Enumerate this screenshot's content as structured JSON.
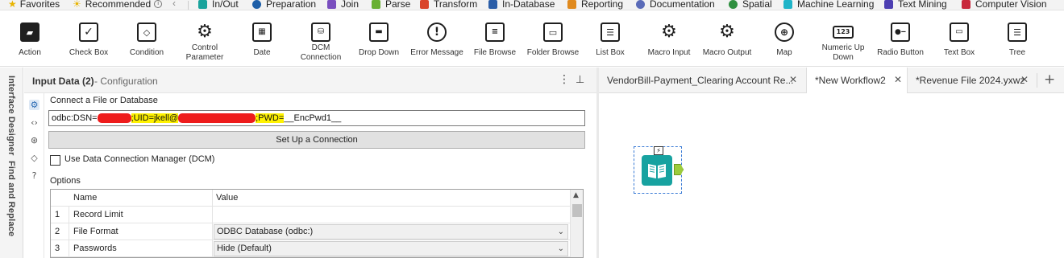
{
  "categories": [
    {
      "label": "Favorites",
      "color": "#e8b400",
      "icon": "star-icon"
    },
    {
      "label": "Recommended",
      "color": "#e8b400",
      "icon": "sun-icon"
    },
    {
      "label": "In/Out",
      "color": "#1aa39c",
      "icon": "in-out-icon"
    },
    {
      "label": "Preparation",
      "color": "#1e5fa8",
      "icon": "preparation-icon"
    },
    {
      "label": "Join",
      "color": "#7a4fbf",
      "icon": "join-icon"
    },
    {
      "label": "Parse",
      "color": "#69b032",
      "icon": "parse-icon"
    },
    {
      "label": "Transform",
      "color": "#d9452b",
      "icon": "transform-icon"
    },
    {
      "label": "In-Database",
      "color": "#2b5ea8",
      "icon": "in-database-icon"
    },
    {
      "label": "Reporting",
      "color": "#e08a1e",
      "icon": "reporting-icon"
    },
    {
      "label": "Documentation",
      "color": "#5a6bb8",
      "icon": "documentation-icon"
    },
    {
      "label": "Spatial",
      "color": "#2f8f3f",
      "icon": "spatial-icon"
    },
    {
      "label": "Machine Learning",
      "color": "#1fb4c8",
      "icon": "machine-learning-icon"
    },
    {
      "label": "Text Mining",
      "color": "#4d3fb2",
      "icon": "text-mining-icon"
    },
    {
      "label": "Computer Vision",
      "color": "#c8283c",
      "icon": "computer-vision-icon"
    }
  ],
  "tools": [
    {
      "label": "Action",
      "icon": "clapperboard-icon"
    },
    {
      "label": "Check Box",
      "icon": "checkbox-icon"
    },
    {
      "label": "Condition",
      "icon": "condition-icon"
    },
    {
      "label": "Control Parameter",
      "icon": "gear-icon"
    },
    {
      "label": "Date",
      "icon": "calendar-icon"
    },
    {
      "label": "DCM Connection",
      "icon": "dcm-icon"
    },
    {
      "label": "Drop Down",
      "icon": "dropdown-icon"
    },
    {
      "label": "Error Message",
      "icon": "error-icon"
    },
    {
      "label": "File Browse",
      "icon": "file-browse-icon"
    },
    {
      "label": "Folder Browse",
      "icon": "folder-icon"
    },
    {
      "label": "List Box",
      "icon": "listbox-icon"
    },
    {
      "label": "Macro Input",
      "icon": "macro-input-icon"
    },
    {
      "label": "Macro Output",
      "icon": "macro-output-icon"
    },
    {
      "label": "Map",
      "icon": "globe-icon"
    },
    {
      "label": "Numeric Up Down",
      "icon": "numeric-icon"
    },
    {
      "label": "Radio Button",
      "icon": "radio-icon"
    },
    {
      "label": "Text Box",
      "icon": "textbox-icon"
    },
    {
      "label": "Tree",
      "icon": "tree-icon"
    }
  ],
  "side": {
    "interface_designer": "Interface Designer",
    "find_replace": "Find and Replace"
  },
  "config": {
    "title": "Input Data (2)",
    "subtitle": "- Configuration",
    "connect_label": "Connect a File or Database",
    "conn_prefix": "odbc:DSN=",
    "conn_uid": ";UID=jkell@",
    "conn_pwd": ";PWD=",
    "conn_tail": "__EncPwd1__",
    "setup_button": "Set Up a Connection",
    "dcm_label": "Use Data Connection Manager (DCM)",
    "options_label": "Options",
    "col_name": "Name",
    "col_value": "Value",
    "rows": [
      {
        "num": "1",
        "name": "Record Limit",
        "value": ""
      },
      {
        "num": "2",
        "name": "File Format",
        "value": "ODBC Database (odbc:)"
      },
      {
        "num": "3",
        "name": "Passwords",
        "value": "Hide (Default)"
      }
    ]
  },
  "workflow_tabs": [
    {
      "label": "VendorBill-Payment_Clearing Account Re...",
      "active": false
    },
    {
      "label": "*New Workflow2",
      "active": true
    },
    {
      "label": "*Revenue File 2024.yxwz",
      "active": false
    }
  ]
}
